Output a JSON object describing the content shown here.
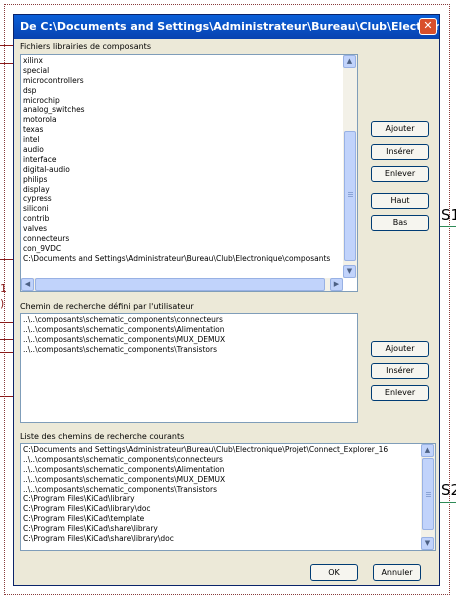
{
  "background": {
    "right_labels": [
      "S1",
      "S2"
    ],
    "left_fragments": [
      "1",
      ")"
    ]
  },
  "dialog": {
    "title": "De C:\\Documents and Settings\\Administrateur\\Bureau\\Club\\Electronique\\Proj...",
    "close_icon": "close-icon"
  },
  "libraries": {
    "label": "Fichiers librairies de composants",
    "items": [
      "xilinx",
      "special",
      "microcontrollers",
      "dsp",
      "microchip",
      "analog_switches",
      "motorola",
      "texas",
      "intel",
      "audio",
      "interface",
      "digital-audio",
      "philips",
      "display",
      "cypress",
      "siliconi",
      "contrib",
      "valves",
      "connecteurs",
      "con_9VDC",
      "C:\\Documents and Settings\\Administrateur\\Bureau\\Club\\Electronique\\composants"
    ],
    "buttons": {
      "add": "Ajouter",
      "insert": "Insérer",
      "remove": "Enlever",
      "up": "Haut",
      "down": "Bas"
    }
  },
  "user_paths": {
    "label": "Chemin de recherche défini par l'utilisateur",
    "items": [
      "..\\..\\composants\\schematic_components\\connecteurs",
      "..\\..\\composants\\schematic_components\\Alimentation",
      "..\\..\\composants\\schematic_components\\MUX_DEMUX",
      "..\\..\\composants\\schematic_components\\Transistors"
    ],
    "buttons": {
      "add": "Ajouter",
      "insert": "Insérer",
      "remove": "Enlever"
    }
  },
  "current_paths": {
    "label": "Liste des chemins de recherche courants",
    "items": [
      "C:\\Documents and Settings\\Administrateur\\Bureau\\Club\\Electronique\\Projet\\Connect_Explorer_16",
      "..\\..\\composants\\schematic_components\\connecteurs",
      "..\\..\\composants\\schematic_components\\Alimentation",
      "..\\..\\composants\\schematic_components\\MUX_DEMUX",
      "..\\..\\composants\\schematic_components\\Transistors",
      "C:\\Program Files\\KiCad\\library",
      "C:\\Program Files\\KiCad\\library\\doc",
      "C:\\Program Files\\KiCad\\template",
      "C:\\Program Files\\KiCad\\share\\library",
      "C:\\Program Files\\KiCad\\share\\library\\doc"
    ]
  },
  "footer": {
    "ok": "OK",
    "cancel": "Annuler"
  }
}
